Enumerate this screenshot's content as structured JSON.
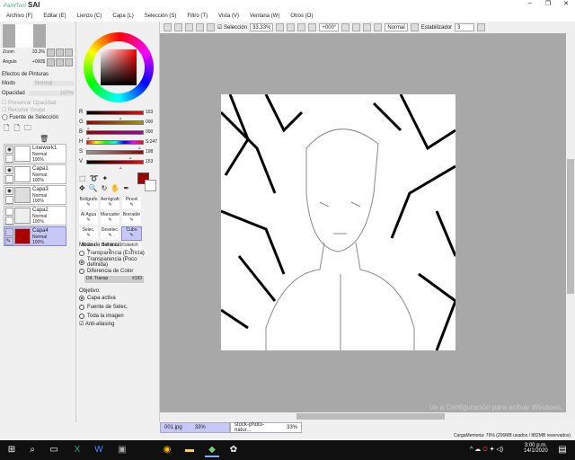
{
  "app": {
    "logo_small": "PaintTool",
    "logo": "SAI"
  },
  "menu": [
    "Archivo (F)",
    "Editar (E)",
    "Lienzo (C)",
    "Capa (L)",
    "Selección (S)",
    "Filtro (T)",
    "Vista (V)",
    "Ventana (W)",
    "Otros (O)"
  ],
  "navigator": {
    "zoom_label": "Zoom",
    "zoom_value": "33.3%",
    "angle_label": "Ángulo",
    "angle_value": "+000$"
  },
  "layer_panel": {
    "effects": "Efectos de Pinturas",
    "mode_label": "Modo",
    "mode_value": "Normal",
    "opacity_label": "Opacidad",
    "opacity_value": "100%",
    "preserve": "Preservar Opacidad",
    "clip": "Recortar Grupo",
    "selection_source": "Fuente de Selección",
    "layers": [
      {
        "name": "Linework1",
        "mode": "Normal",
        "opacity": "100%"
      },
      {
        "name": "Capa1",
        "mode": "Normal",
        "opacity": "100%"
      },
      {
        "name": "Capa3",
        "mode": "Normal",
        "opacity": "100%"
      },
      {
        "name": "Capa2",
        "mode": "Normal",
        "opacity": "100%"
      },
      {
        "name": "Capa4",
        "mode": "Normal",
        "opacity": "100%"
      }
    ]
  },
  "color": {
    "current": "#990000",
    "sliders": [
      {
        "label": "R",
        "value": "153",
        "pct": 0.6
      },
      {
        "label": "G",
        "value": "000",
        "pct": 0
      },
      {
        "label": "B",
        "value": "000",
        "pct": 0
      },
      {
        "label": "H",
        "value": "S:247",
        "pct": 0.95
      },
      {
        "label": "S",
        "value": "198",
        "pct": 0.78
      },
      {
        "label": "V",
        "value": "153",
        "pct": 0.6
      }
    ]
  },
  "tools": [
    "Bolígrafo",
    "Aerógrafo",
    "Pincel",
    "Al Agua",
    "Marcador",
    "Borrador",
    "Selec.",
    "Deselec.",
    "Cubo",
    "Binario",
    "Boli tinta",
    "sketch"
  ],
  "bucket": {
    "detection_label": "Modo de detección:",
    "detection": [
      "Transparencia (Estricta)",
      "Transparencia (Poco definida)",
      "Diferencia de Color"
    ],
    "detection_selected": 1,
    "dif_label": "Dif. Transp",
    "dif_value": "±193",
    "target_label": "Objetivo:",
    "targets": [
      "Capa activa",
      "Fuente de Selec.",
      "Toda la imagen"
    ],
    "target_selected": 0,
    "antialias": "Anti-aliasing"
  },
  "toolbar": {
    "selection": "Selección",
    "zoom": "33.33%",
    "angle": "+000°",
    "blend": "Normal",
    "stabilizer_label": "Estabilizador",
    "stabilizer": "3"
  },
  "tabs": [
    {
      "name": "001.jpg",
      "zoom": "33%"
    },
    {
      "name": "stock-photo-natur...",
      "zoom": "33%"
    }
  ],
  "watermark": "Ve a Configuración para activar Windows.",
  "status": "CargaMemoria: 76% (206MB usados / 882MB reservados)",
  "clock": {
    "time": "3:00 p.m.",
    "date": "14/1/2020"
  }
}
